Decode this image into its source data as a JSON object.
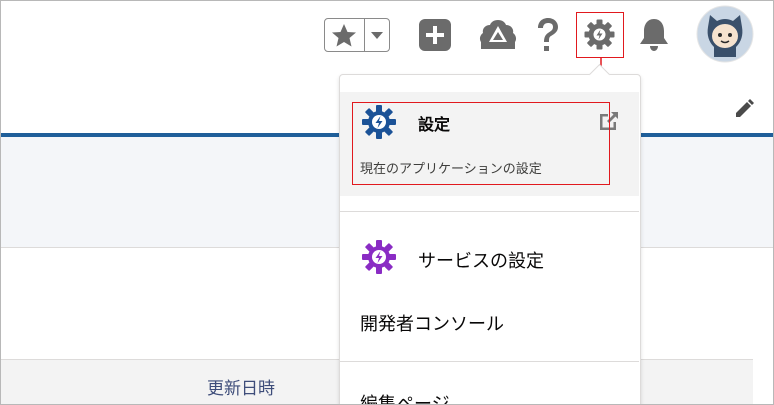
{
  "header": {
    "icons": [
      "star-icon",
      "chevron-down-icon",
      "plus-icon",
      "trailhead-icon",
      "question-icon",
      "gear-icon",
      "bell-icon",
      "avatar"
    ]
  },
  "page": {
    "column_header": "更新日時"
  },
  "menu": {
    "setup_title": "設定",
    "setup_subtitle": "現在のアプリケーションの設定",
    "service_setup": "サービスの設定",
    "developer_console": "開発者コンソール",
    "edit_page": "編集ページ"
  },
  "colors": {
    "accent_blue": "#1f5f9a",
    "setup_gear": "#1b5297",
    "service_gear": "#8a2cc4",
    "highlight_red": "#e1191e"
  }
}
